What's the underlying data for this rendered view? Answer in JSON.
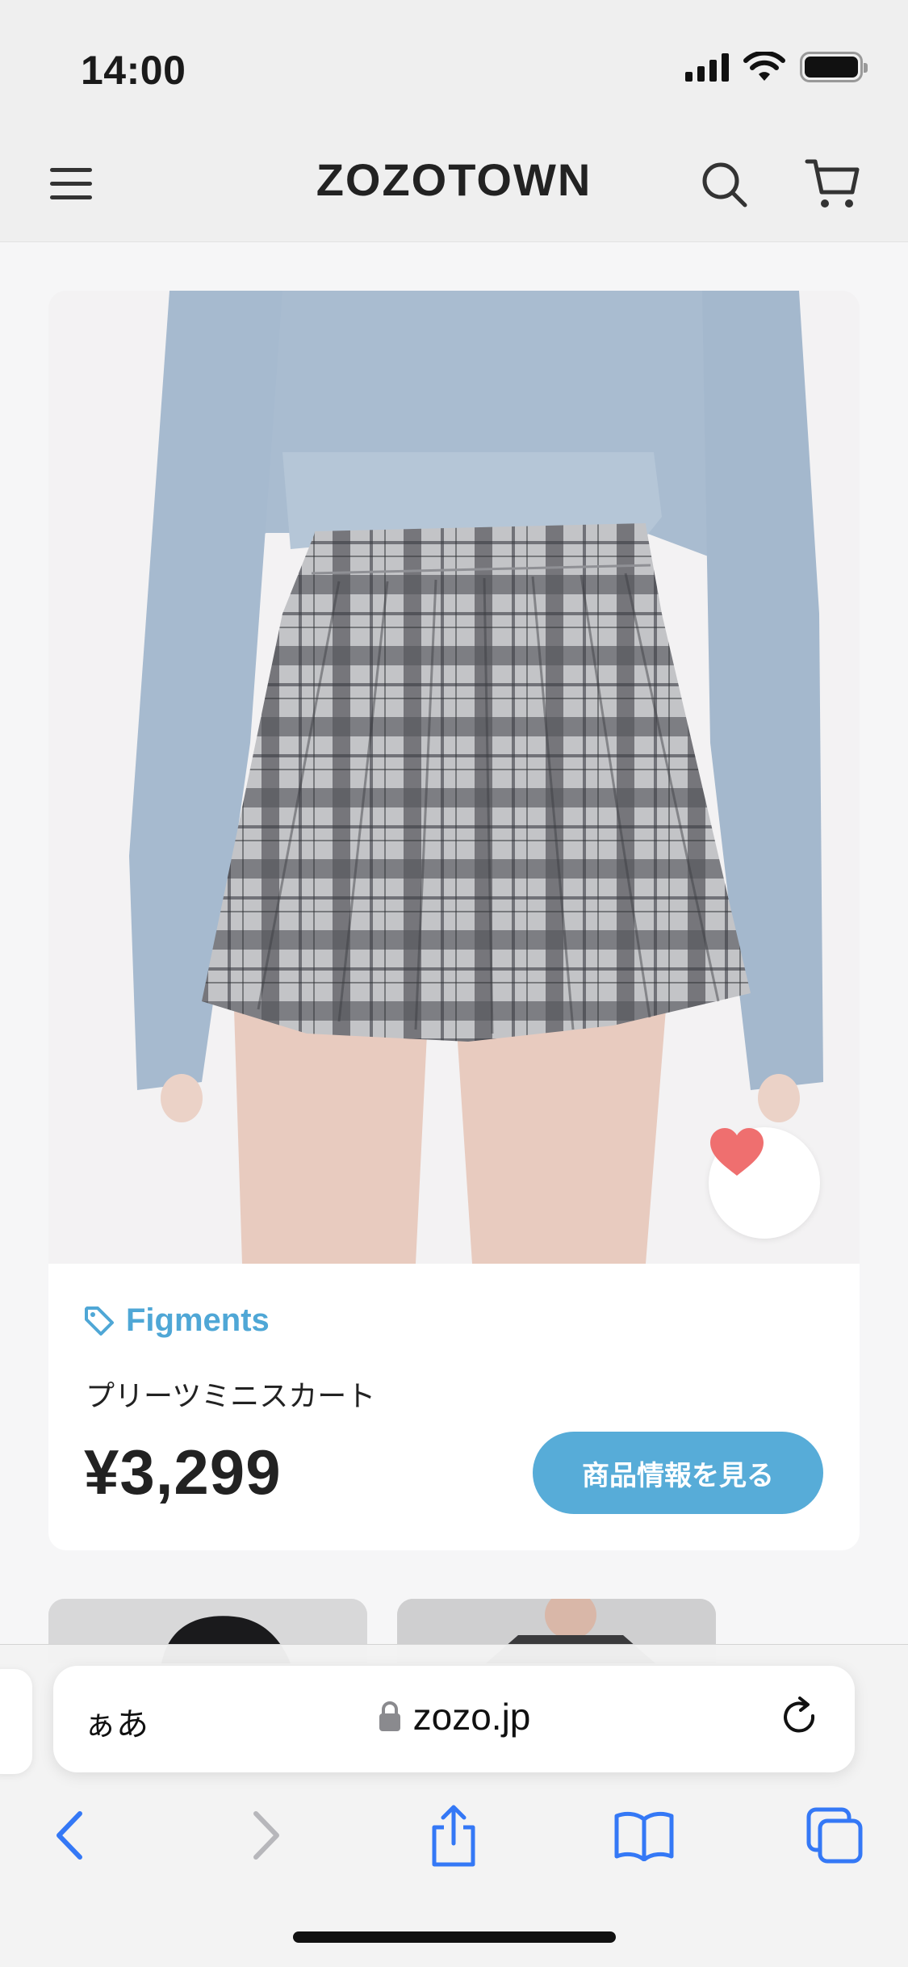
{
  "status_bar": {
    "time": "14:00"
  },
  "header": {
    "logo": "ZOZOTOWN"
  },
  "product": {
    "brand": "Figments",
    "name": "プリーツミニスカート",
    "price": "¥3,299",
    "view_button_label": "商品情報を見る",
    "favorited": true
  },
  "browser": {
    "text_size_label": "ぁあ",
    "url": "zozo.jp"
  },
  "colors": {
    "brand_blue": "#4fa7d6",
    "button_blue": "#57acd8",
    "heart": "#ef6f6f",
    "ios_blue": "#3478f6"
  }
}
